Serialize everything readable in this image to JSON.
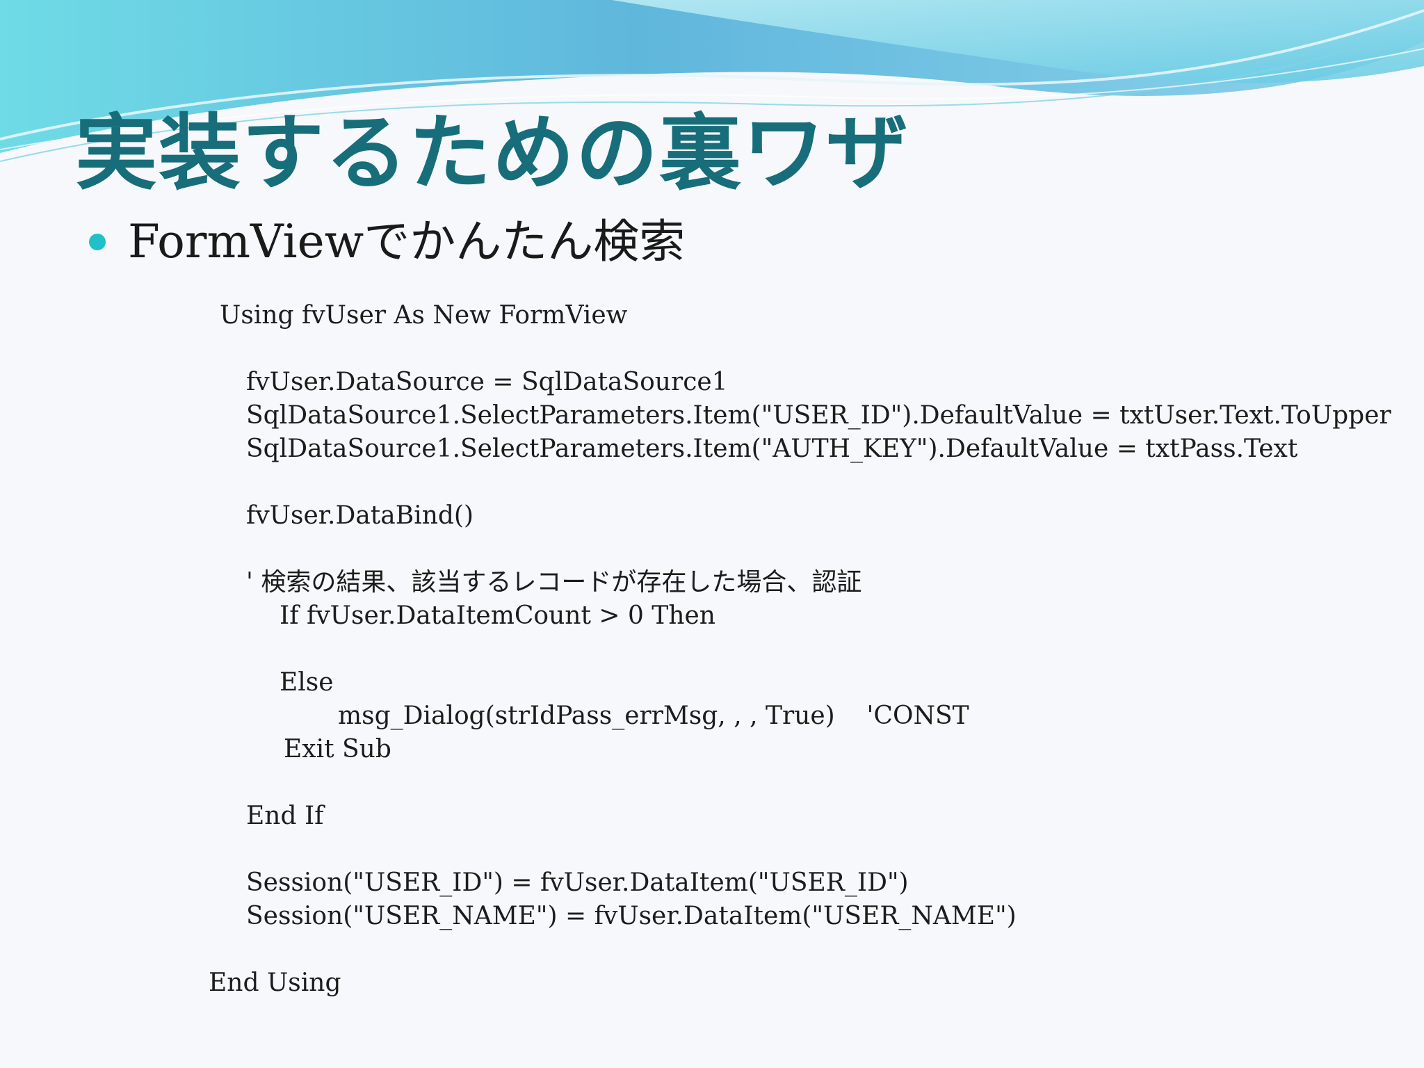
{
  "slide": {
    "title": "実装するための裏ワザ",
    "bullet": "FormViewでかんたん検索",
    "accent_color": "#1fc1c9",
    "title_color": "#176e7a",
    "code_lines": [
      "Using fvUser As New FormView",
      "fvUser.DataSource = SqlDataSource1",
      "SqlDataSource1.SelectParameters.Item(\"USER_ID\").DefaultValue = txtUser.Text.ToUpper",
      "SqlDataSource1.SelectParameters.Item(\"AUTH_KEY\").DefaultValue = txtPass.Text",
      "fvUser.DataBind()",
      "' 検索の結果、該当するレコードが存在した場合、認証",
      "If fvUser.DataItemCount > 0 Then",
      "Else",
      "msg_Dialog(strIdPass_errMsg, , , True)    'CONST",
      "Exit Sub",
      "End If",
      "Session(\"USER_ID\") = fvUser.DataItem(\"USER_ID\")",
      "Session(\"USER_NAME\") = fvUser.DataItem(\"USER_NAME\")",
      "End Using"
    ]
  }
}
